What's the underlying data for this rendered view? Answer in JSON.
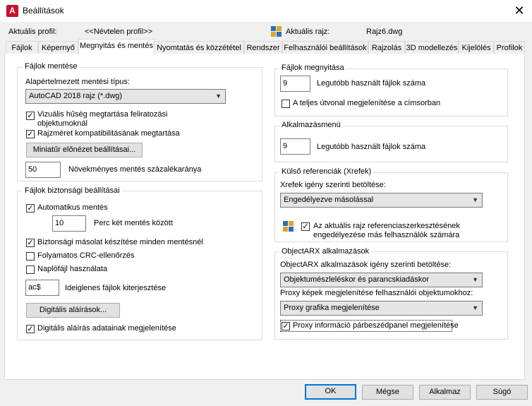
{
  "window": {
    "title": "Beállítások",
    "close": "✕"
  },
  "header": {
    "profile_label": "Aktuális profil:",
    "profile_value": "<<Névtelen profil>>",
    "drawing_label": "Aktuális rajz:",
    "drawing_value": "Rajz6.dwg"
  },
  "tabs": [
    "Fájlok",
    "Képernyő",
    "Megnyitás és mentés",
    "Nyomtatás és közzététel",
    "Rendszer",
    "Felhasználói beállítások",
    "Rajzolás",
    "3D modellezés",
    "Kijelölés",
    "Profilok"
  ],
  "save": {
    "group": "Fájlok mentése",
    "type_label": "Alapértelmezett mentési típus:",
    "type_value": "AutoCAD 2018 rajz (*.dwg)",
    "visual_fidelity": "Vizuális hűség megtartása feliratozási objektumoknál",
    "drawing_size": "Rajzméret kompatibilitásának megtartása",
    "thumbnail_button": "Miniatűr előnézet beállításai...",
    "incremental_value": "50",
    "incremental_label": "Növekményes mentés százalékaránya"
  },
  "safety": {
    "group": "Fájlok biztonsági beállításai",
    "autosave": "Automatikus mentés",
    "minutes_value": "10",
    "minutes_label": "Perc két mentés között",
    "backup": "Biztonsági másolat készítése minden mentésnél",
    "crc": "Folyamatos CRC-ellenőrzés",
    "log": "Naplófájl használata",
    "ext_value": "ac$",
    "ext_label": "Ideiglenes fájlok kiterjesztése",
    "digsig_button": "Digitális aláírások...",
    "digsig_display": "Digitális aláírás adatainak megjelenítése"
  },
  "open": {
    "group": "Fájlok megnyitása",
    "recent_value": "9",
    "recent_label": "Legutóbb használt fájlok száma",
    "full_path": "A teljes útvonal megjelenítése a címsorban"
  },
  "appmenu": {
    "group": "Alkalmazásmenü",
    "recent_value": "9",
    "recent_label": "Legutóbb használt fájlok száma"
  },
  "xref": {
    "group": "Külső referenciák (Xrefek)",
    "demand_label": "Xrefek igény szerinti betöltése:",
    "demand_value": "Engedélyezve másolással",
    "allow": "Az aktuális rajz referenciaszerkesztésének engedélyezése más felhasználók számára"
  },
  "arx": {
    "group": "ObjectARX alkalmazások",
    "demand_label": "ObjectARX alkalmazások igény szerinti betöltése:",
    "demand_value": "Objektumészleléskor és parancskiadáskor",
    "proxy_label": "Proxy képek megjelenítése felhasználói objektumokhoz:",
    "proxy_value": "Proxy grafika megjelenítése",
    "proxy_dialog": "Proxy információ párbeszédpanel megjelenítése"
  },
  "footer": {
    "ok": "OK",
    "cancel": "Mégse",
    "apply": "Alkalmaz",
    "help": "Súgó"
  }
}
